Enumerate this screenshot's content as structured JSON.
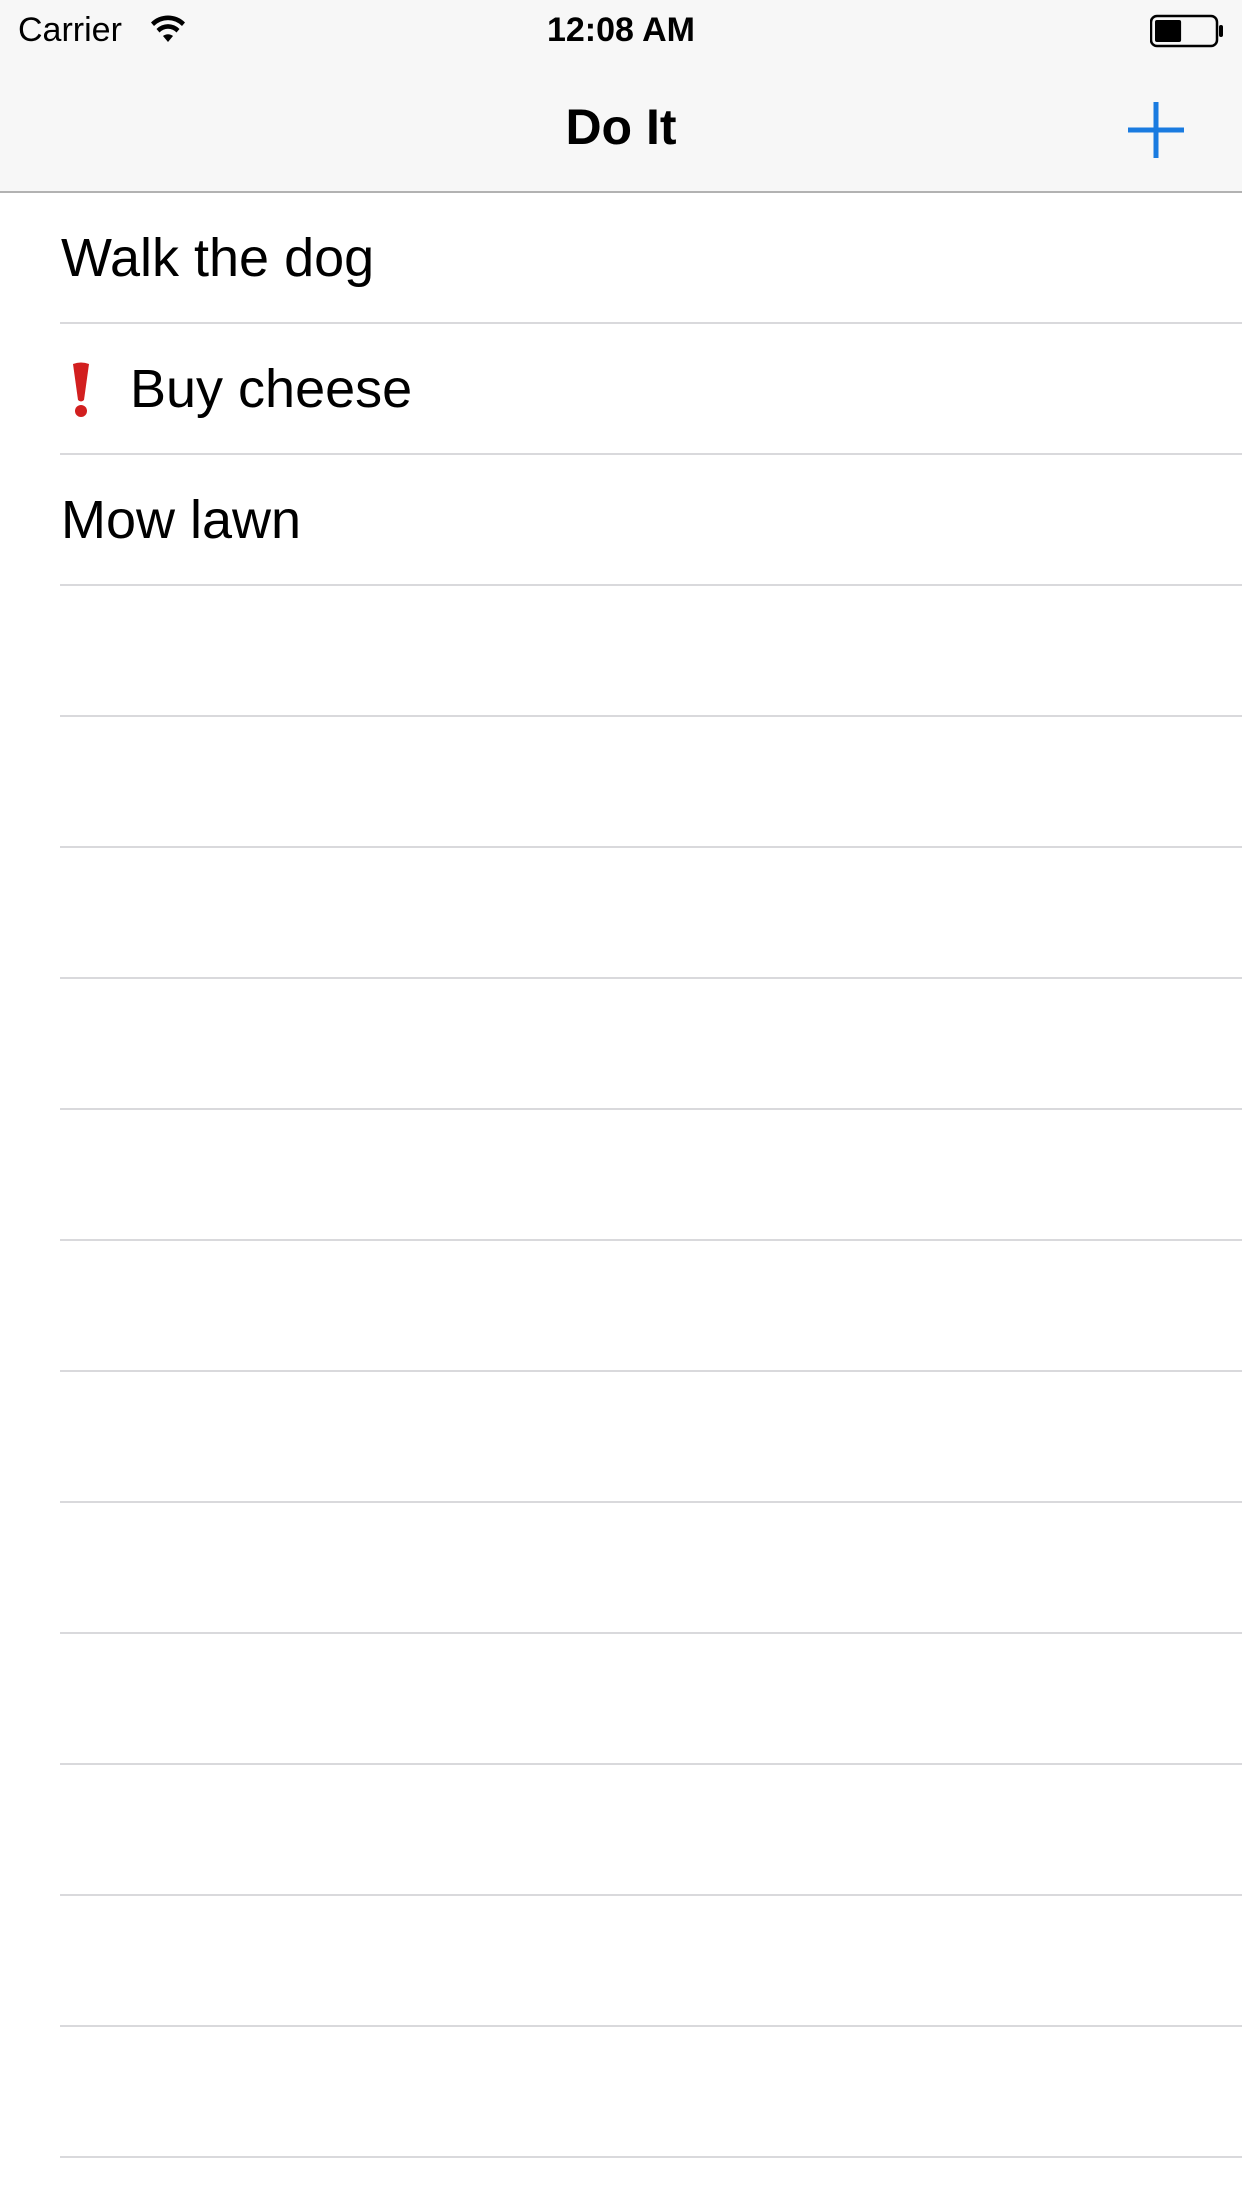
{
  "status_bar": {
    "carrier": "Carrier",
    "time": "12:08 AM",
    "wifi_icon": "wifi-icon",
    "battery_icon": "battery-icon",
    "battery_level": 0.45
  },
  "nav": {
    "title": "Do It",
    "add_icon": "plus-icon",
    "accent_color": "#1a7be0"
  },
  "tasks": [
    {
      "title": "Walk the dog",
      "important": false
    },
    {
      "title": "Buy cheese",
      "important": true
    },
    {
      "title": "Mow lawn",
      "important": false
    }
  ],
  "colors": {
    "bar_background": "#f7f7f7",
    "separator": "#d9d9dc",
    "important_flag": "#d21f1f"
  }
}
